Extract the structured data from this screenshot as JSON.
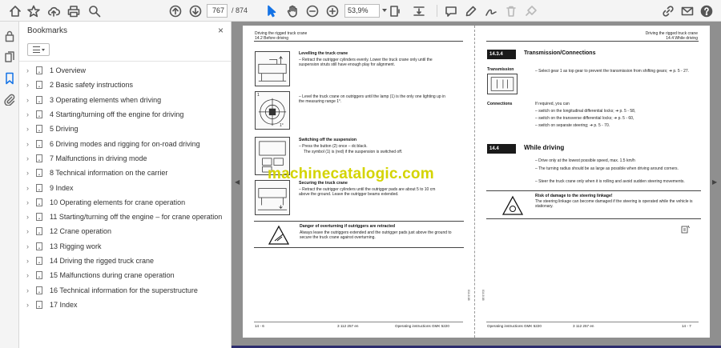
{
  "toolbar": {
    "current_page": "767",
    "total_pages": "/ 874",
    "zoom": "53,9%"
  },
  "bookmarks": {
    "title": "Bookmarks",
    "close": "×",
    "items": [
      {
        "label": "1 Overview"
      },
      {
        "label": "2 Basic safety instructions"
      },
      {
        "label": "3 Operating elements when driving"
      },
      {
        "label": "4 Starting/turning off the engine for driving"
      },
      {
        "label": "5 Driving"
      },
      {
        "label": "6 Driving modes and rigging for on-road driving"
      },
      {
        "label": "7 Malfunctions in driving mode"
      },
      {
        "label": "8 Technical information on the carrier"
      },
      {
        "label": "9 Index"
      },
      {
        "label": "10 Operating elements for crane operation"
      },
      {
        "label": "11 Starting/turning off the engine – for crane operation"
      },
      {
        "label": "12 Crane operation"
      },
      {
        "label": "13 Rigging work"
      },
      {
        "label": "14 Driving the rigged truck crane"
      },
      {
        "label": "15 Malfunctions during crane operation"
      },
      {
        "label": "16 Technical information for the superstructure"
      },
      {
        "label": "17 Index"
      }
    ]
  },
  "left_page": {
    "header_title": "Driving the rigged truck crane",
    "header_sub": "14.2 Before driving",
    "leveling_title": "Levelling the truck crane",
    "leveling_text": "– Retract the outrigger cylinders evenly. Lower the truck crane only until the suspension struts still have enough play for alignment.",
    "lamp_text": "– Level the truck crane on outriggers until the lamp (1) is the only one lighting up in the measuring range 1°.",
    "suspension_title": "Switching off the suspension",
    "suspension_text1": "– Press the button (2) once – dc:black.",
    "suspension_text2": "The symbol (1) is (red) if the suspension is switched off.",
    "securing_title": "Securing the truck crane",
    "securing_text": "– Retract the outrigger cylinders until the outrigger pads are about 5 to 10 cm above the ground. Leave the outrigger beams extended.",
    "danger_title": "Danger of overturning if outriggers are retracted",
    "danger_text": "Always leave the outriggers extended and the outrigger pads just above the ground to secure the truck crane against overturning.",
    "fig_label_1": "1",
    "fig_label_2": "1°",
    "footer_page": "14 - 6",
    "footer_doc": "3 112 257 en",
    "footer_title": "Operating instructions GMK 5220",
    "margin_code": "014.8.88"
  },
  "right_page": {
    "header_title": "Driving the rigged truck crane",
    "header_sub": "14.4 While driving",
    "sec1_num": "14.3.4",
    "sec1_title": "Transmission/Connections",
    "transmission_label": "Transmission",
    "transmission_text": "– Select gear 1 as top gear to prevent the transmission from shifting gears; ➜ p. 5 - 27.",
    "connections_label": "Connections",
    "connections_intro": "If required, you can",
    "conn_1": "– switch on the longitudinal differential locks; ➜ p. 5 - 58,",
    "conn_2": "– switch on the transverse differential locks; ➜ p. 5 - 60,",
    "conn_3": "– switch on separate steering; ➜ p. 5 - 70.",
    "sec2_num": "14.4",
    "sec2_title": "While driving",
    "drive_1": "– Drive only at the lowest possible speed, max. 1.5 km/h",
    "drive_2": "– The turning radius should be as large as possible when driving around corners.",
    "drive_3": "– Steer the truck crane only when it is rolling and avoid sudden steering movements.",
    "risk_title": "Risk of damage to the steering linkage!",
    "risk_text": "The steering linkage can become damaged if the steering is operated while the vehicle is stationary.",
    "footer_title": "Operating instructions GMK 5220",
    "footer_doc": "3 112 257 en",
    "footer_page": "14 - 7",
    "margin_code": "014.8.88"
  },
  "watermark": "machinecatalogic.com"
}
